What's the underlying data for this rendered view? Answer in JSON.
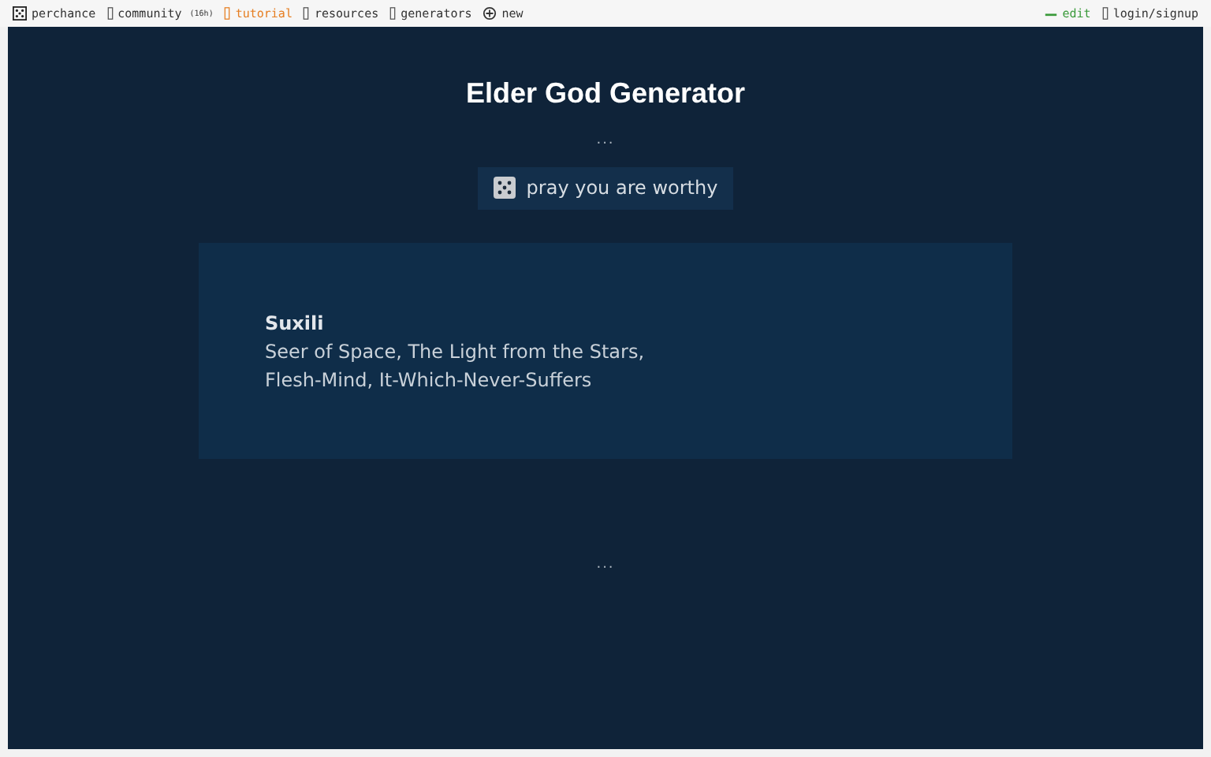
{
  "nav": {
    "left": [
      {
        "label": "perchance",
        "kind": "logo",
        "selected": false
      },
      {
        "label": "community",
        "badge": "(16h)",
        "kind": "link",
        "selected": false
      },
      {
        "label": "tutorial",
        "kind": "link",
        "selected": true
      },
      {
        "label": "resources",
        "kind": "link",
        "selected": false
      },
      {
        "label": "generators",
        "kind": "link",
        "selected": false
      },
      {
        "label": "new",
        "kind": "new",
        "selected": false
      }
    ],
    "right": [
      {
        "label": "edit",
        "kind": "edit",
        "selected": false
      },
      {
        "label": "login/signup",
        "kind": "link",
        "selected": false
      }
    ]
  },
  "title": "Elder God Generator",
  "top_ellipsis": "...",
  "button": {
    "label": "pray you are worthy"
  },
  "result": {
    "name": "Suxili",
    "lines": [
      "Seer of Space, The Light from the Stars,",
      "Flesh-Mind, It-Which-Never-Suffers"
    ]
  },
  "bottom_ellipsis": "..."
}
